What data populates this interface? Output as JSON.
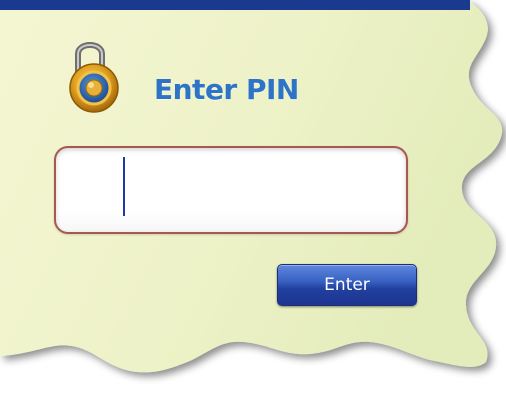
{
  "header": {
    "lock_icon": "padlock-icon",
    "title": "Enter PIN"
  },
  "pin_input": {
    "value": "",
    "placeholder": ""
  },
  "actions": {
    "enter_label": "Enter"
  },
  "colors": {
    "top_bar": "#1a3a8f",
    "panel_background": "#eef2c8",
    "title_text": "#2d74c8",
    "input_border": "#a9584f",
    "button_top": "#5e87dd",
    "button_bottom": "#1d3690"
  }
}
